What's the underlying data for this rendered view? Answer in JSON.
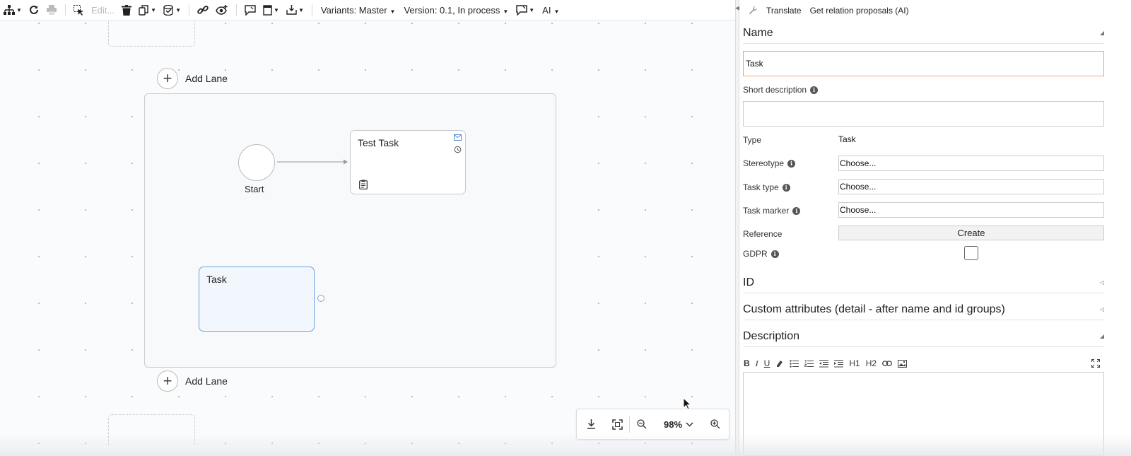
{
  "toolbar": {
    "edit_label": "Edit...",
    "variants_label": "Variants: Master",
    "version_label": "Version: 0.1, In process",
    "ai_label": "AI"
  },
  "canvas": {
    "add_lane_top": "Add Lane",
    "add_lane_bottom": "Add Lane",
    "start_label": "Start",
    "task1_name": "Test Task",
    "task2_name": "Task"
  },
  "zoom": {
    "level": "98%"
  },
  "panel": {
    "translate_label": "Translate",
    "relation_label": "Get relation proposals (AI)",
    "name_section": "Name",
    "name_value": "Task",
    "short_desc_label": "Short description",
    "short_desc_value": "",
    "type_label": "Type",
    "type_value": "Task",
    "stereotype_label": "Stereotype",
    "stereotype_value": "Choose...",
    "task_type_label": "Task type",
    "task_type_value": "Choose...",
    "task_marker_label": "Task marker",
    "task_marker_value": "Choose...",
    "reference_label": "Reference",
    "create_label": "Create",
    "gdpr_label": "GDPR",
    "id_section": "ID",
    "custom_section": "Custom attributes (detail - after name and id groups)",
    "desc_section": "Description",
    "rte_tools": [
      "B",
      "I",
      "U",
      "H1",
      "H2"
    ]
  }
}
